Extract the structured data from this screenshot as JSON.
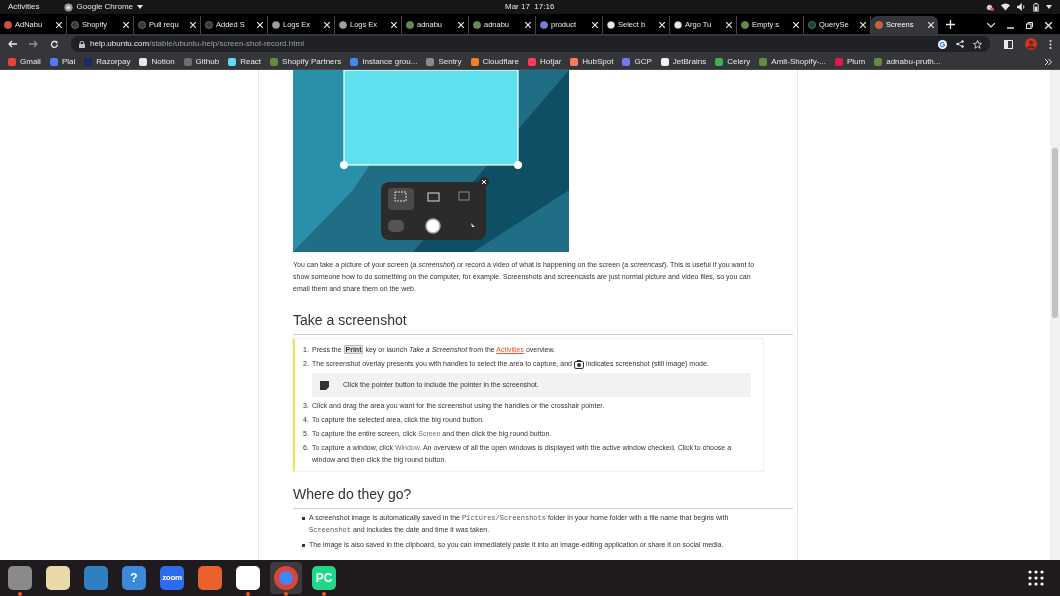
{
  "top_bar": {
    "activities": "Activities",
    "app_menu": "Google Chrome",
    "clock": "Mar 17  17:16"
  },
  "tabs": [
    {
      "title": "AdNabu",
      "kind": "gmail",
      "selected": false
    },
    {
      "title": "Shopify",
      "kind": "github",
      "selected": false
    },
    {
      "title": "Pull requ",
      "kind": "github",
      "selected": false
    },
    {
      "title": "Added S",
      "kind": "github",
      "selected": false
    },
    {
      "title": "Logs Ex",
      "kind": "logs",
      "selected": false
    },
    {
      "title": "Logs Ex",
      "kind": "logs",
      "selected": false
    },
    {
      "title": "adnabu",
      "kind": "shopify",
      "selected": false
    },
    {
      "title": "adnabu",
      "kind": "shopify",
      "selected": false
    },
    {
      "title": "product",
      "kind": "stack",
      "selected": false
    },
    {
      "title": "Select b",
      "kind": "globe",
      "selected": false
    },
    {
      "title": "Argo Tu",
      "kind": "globe",
      "selected": false
    },
    {
      "title": "Empty s",
      "kind": "shopify",
      "selected": false
    },
    {
      "title": "QuerySe",
      "kind": "django",
      "selected": false
    },
    {
      "title": "Screens",
      "kind": "ubuntu",
      "selected": true
    }
  ],
  "address_bar": {
    "host": "help.ubuntu.com",
    "path": "/stable/ubuntu-help/screen-shot-record.html"
  },
  "bookmarks": [
    {
      "label": "Gmail",
      "color": "#ea4335"
    },
    {
      "label": "Plai",
      "color": "#4f7cf7"
    },
    {
      "label": "Razorpay",
      "color": "#1b2a6b"
    },
    {
      "label": "Notion",
      "color": "#e8e8e8"
    },
    {
      "label": "Github",
      "color": "#6e6e6e"
    },
    {
      "label": "React",
      "color": "#61dafb"
    },
    {
      "label": "Shopify Partners",
      "color": "#5e8e3e"
    },
    {
      "label": "Instance grou...",
      "color": "#4285f4"
    },
    {
      "label": "Sentry",
      "color": "#8a8a8a"
    },
    {
      "label": "Cloudflare",
      "color": "#f48120"
    },
    {
      "label": "Hotjar",
      "color": "#fd3a5c"
    },
    {
      "label": "HubSpot",
      "color": "#ff7a59"
    },
    {
      "label": "GCP",
      "color": "#6e7cf0"
    },
    {
      "label": "JetBrains",
      "color": "#f2f2f2"
    },
    {
      "label": "Celery",
      "color": "#37b24d"
    },
    {
      "label": "Amit-Shopify-...",
      "color": "#5e8e3e"
    },
    {
      "label": "Plum",
      "color": "#e5184e"
    },
    {
      "label": "adnabu-pruth...",
      "color": "#5e8e3e"
    }
  ],
  "article": {
    "intro": "You can take a picture of your screen (a *screenshot*) or record a video of what is happening on the screen (a *screencast*). This is useful if you want to show someone how to do something on the computer, for example. Screenshots and screencasts are just normal picture and video files, so you can email them and share them on the web.",
    "sections": [
      {
        "heading": "Take a screenshot",
        "kind": "steps",
        "items": [
          {
            "number": "1.",
            "parts": [
              {
                "kind": "text",
                "text": "Press the "
              },
              {
                "kind": "key",
                "text": "Print"
              },
              {
                "kind": "text",
                "text": " key or launch "
              },
              {
                "kind": "italic",
                "text": "Take a Screenshot"
              },
              {
                "kind": "text",
                "text": " from the "
              },
              {
                "kind": "link",
                "text": "Activities"
              },
              {
                "kind": "text",
                "text": " overview."
              }
            ]
          },
          {
            "number": "2.",
            "parts": [
              {
                "kind": "text",
                "text": "The screenshot overlay presents you with handles to select the area to capture, and "
              },
              {
                "kind": "camera"
              },
              {
                "kind": "text",
                "text": " indicates screenshot (still image) mode."
              }
            ]
          },
          {
            "note": "Click the pointer button to include the pointer in the screenshot."
          },
          {
            "number": "3.",
            "parts": [
              {
                "kind": "text",
                "text": "Click and drag the area you want for the screenshot using the handles or the crosshair pointer."
              }
            ]
          },
          {
            "number": "4.",
            "parts": [
              {
                "kind": "text",
                "text": "To capture the selected area, click the big round button."
              }
            ]
          },
          {
            "number": "5.",
            "parts": [
              {
                "kind": "text",
                "text": "To capture the entire screen, click "
              },
              {
                "kind": "gui",
                "text": "Screen"
              },
              {
                "kind": "text",
                "text": " and then click the big round button."
              }
            ]
          },
          {
            "number": "6.",
            "parts": [
              {
                "kind": "text",
                "text": "To capture a window, click "
              },
              {
                "kind": "gui",
                "text": "Window"
              },
              {
                "kind": "text",
                "text": ". An overview of all the open windows is displayed with the active window checked. Click to choose a window and then click the big round button."
              }
            ]
          }
        ]
      },
      {
        "heading": "Where do they go?",
        "kind": "bullets",
        "items": [
          {
            "parts": [
              {
                "kind": "text",
                "text": "A screenshot image is automatically saved in the "
              },
              {
                "kind": "code",
                "text": "Pictures/Screenshots"
              },
              {
                "kind": "text",
                "text": " folder in your home folder with a file name that begins with "
              },
              {
                "kind": "code",
                "text": "Screenshot"
              },
              {
                "kind": "text",
                "text": " and includes the date and time it was taken."
              }
            ]
          },
          {
            "parts": [
              {
                "kind": "text",
                "text": "The image is also saved in the clipboard, so you can immediately paste it into an image-editing application or share it on social media."
              }
            ]
          }
        ]
      }
    ]
  },
  "dock": [
    {
      "kind": "files",
      "running": true,
      "selected": false
    },
    {
      "kind": "music",
      "running": false,
      "selected": false
    },
    {
      "kind": "writer",
      "running": false,
      "selected": false
    },
    {
      "kind": "help",
      "logo_text": "?",
      "running": false,
      "selected": false
    },
    {
      "kind": "zoom",
      "logo_text": "zoom",
      "running": false,
      "selected": false
    },
    {
      "kind": "store",
      "running": false,
      "selected": false
    },
    {
      "kind": "slack",
      "running": true,
      "selected": false
    },
    {
      "kind": "chrome",
      "running": true,
      "selected": true
    },
    {
      "kind": "pycharm",
      "logo_text": "PC",
      "running": true,
      "selected": false
    }
  ]
}
